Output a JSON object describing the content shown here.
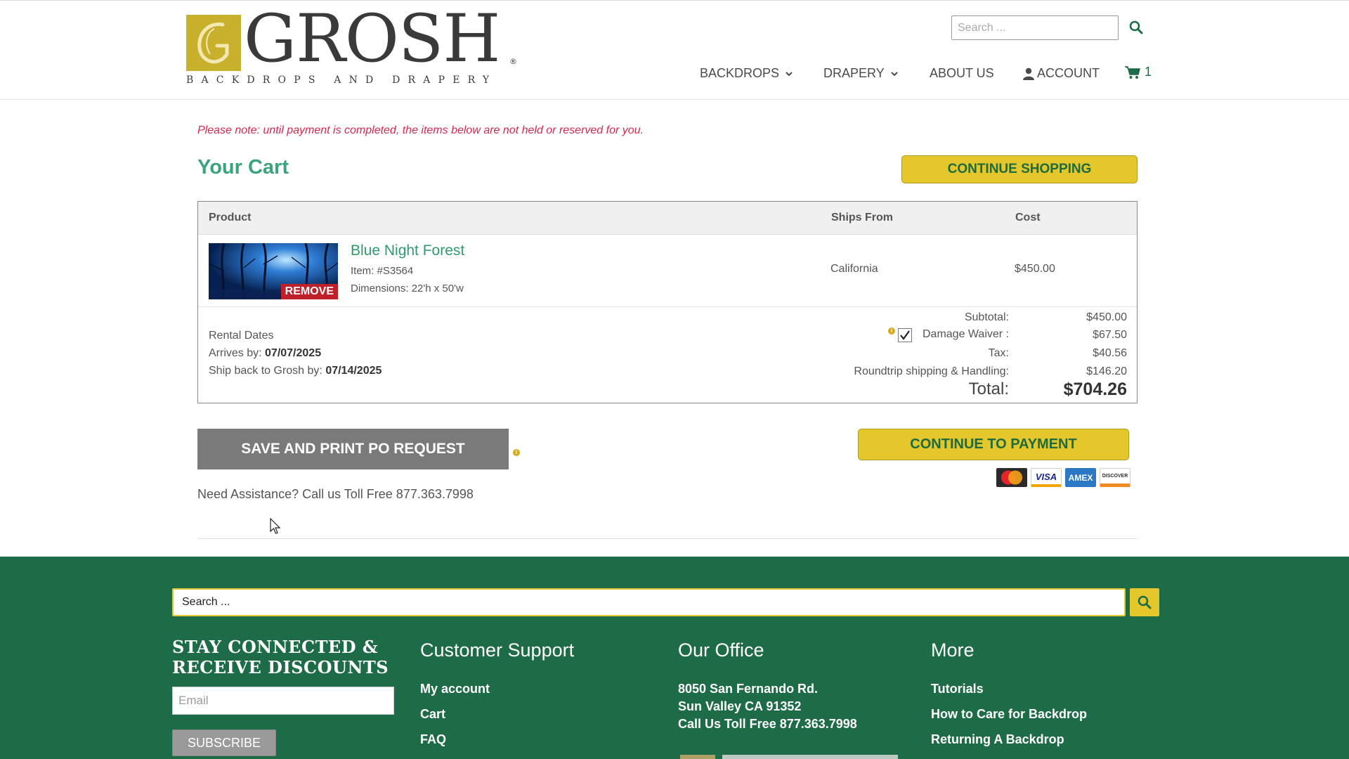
{
  "header": {
    "logo": {
      "word": "GROSH",
      "tagline": "BACKDROPS AND DRAPERY",
      "registered": "®"
    },
    "search_placeholder": "Search ...",
    "nav": {
      "backdrops": "BACKDROPS",
      "drapery": "DRAPERY",
      "about": "ABOUT US",
      "account": "ACCOUNT",
      "cart_count": "1"
    }
  },
  "main": {
    "note": "Please note: until payment is completed, the items below are not held or reserved for you.",
    "title": "Your Cart",
    "continue_shopping": "CONTINUE SHOPPING",
    "table": {
      "headers": {
        "product": "Product",
        "ships_from": "Ships From",
        "cost": "Cost"
      },
      "item": {
        "name": "Blue Night Forest",
        "item_no": "Item: #S3564",
        "dimensions": "Dimensions: 22'h x 50'w",
        "remove": "REMOVE",
        "ships_from": "California",
        "cost": "$450.00"
      },
      "rental": {
        "title": "Rental Dates",
        "arrives_label": "Arrives by: ",
        "arrives_date": "07/07/2025",
        "ship_back_label": "Ship back to Grosh by: ",
        "ship_back_date": "07/14/2025"
      },
      "summary": {
        "subtotal_label": "Subtotal:",
        "subtotal": "$450.00",
        "waiver_label": "Damage Waiver :",
        "waiver": "$67.50",
        "tax_label": "Tax:",
        "tax": "$40.56",
        "shipping_label": "Roundtrip shipping & Handling:",
        "shipping": "$146.20",
        "total_label": "Total:",
        "total": "$704.26"
      }
    },
    "save_po": "SAVE AND PRINT PO REQUEST",
    "continue_payment": "CONTINUE TO PAYMENT",
    "cards": {
      "mastercard": "MasterCard",
      "visa": "VISA",
      "amex": "AMEX",
      "discover": "DISCOVER"
    },
    "assist": "Need Assistance? Call us Toll Free 877.363.7998"
  },
  "footer": {
    "search_placeholder": "Search ...",
    "stay_line1": "STAY CONNECTED &",
    "stay_line2": "RECEIVE DISCOUNTS",
    "email_placeholder": "Email",
    "subscribe": "SUBSCRIBE",
    "support": {
      "title": "Customer Support",
      "links": [
        "My account",
        "Cart",
        "FAQ"
      ]
    },
    "office": {
      "title": "Our Office",
      "lines": [
        "8050 San Fernando Rd.",
        "Sun Valley CA 91352",
        "Call Us Toll Free 877.363.7998"
      ]
    },
    "more": {
      "title": "More",
      "links": [
        "Tutorials",
        "How to Care for Backdrop",
        "Returning A Backdrop"
      ]
    }
  },
  "colors": {
    "brand_green": "#1d6b47",
    "accent_gold": "#e3c72b",
    "title_green": "#3aa57a",
    "note_red": "#d6284e"
  }
}
